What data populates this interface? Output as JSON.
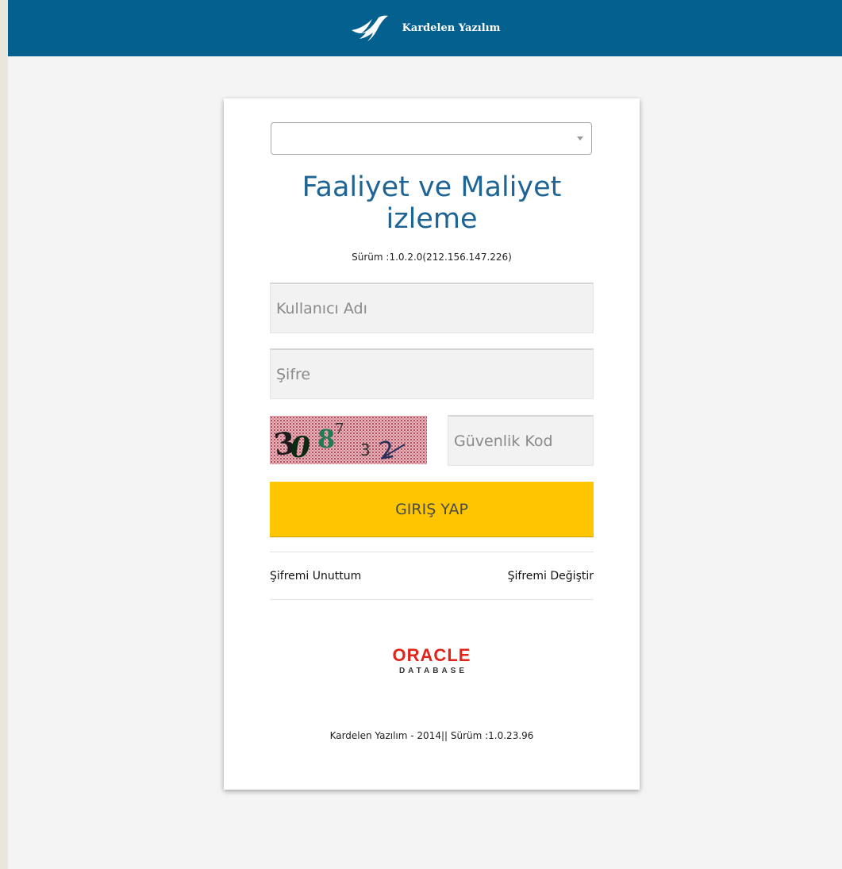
{
  "header": {
    "brand_name": "Kardelen Yazılım",
    "brand_logo_icon": "kardelen-logo-icon",
    "background_color": "#04608f"
  },
  "login": {
    "select_value": "",
    "title_line1": "Faaliyet ve Maliyet",
    "title_line2": "izleme",
    "version": "Sürüm :1.0.2.0(212.156.147.226)",
    "username_placeholder": "Kullanıcı Adı",
    "password_placeholder": "Şifre",
    "captcha_text": "308 3 2",
    "security_code_placeholder": "Güvenlik Kod",
    "login_button": "GIRIŞ YAP",
    "forgot_password": "Şifremi Unuttum",
    "change_password": "Şifremi Değiştir",
    "title_color": "#1e6494",
    "button_color": "#ffc600"
  },
  "oracle": {
    "word": "ORACLE",
    "sub": "DATABASE",
    "color": "#e2231a"
  },
  "footer": {
    "text": "Kardelen Yazılım - 2014|| Sürüm :1.0.23.96"
  }
}
